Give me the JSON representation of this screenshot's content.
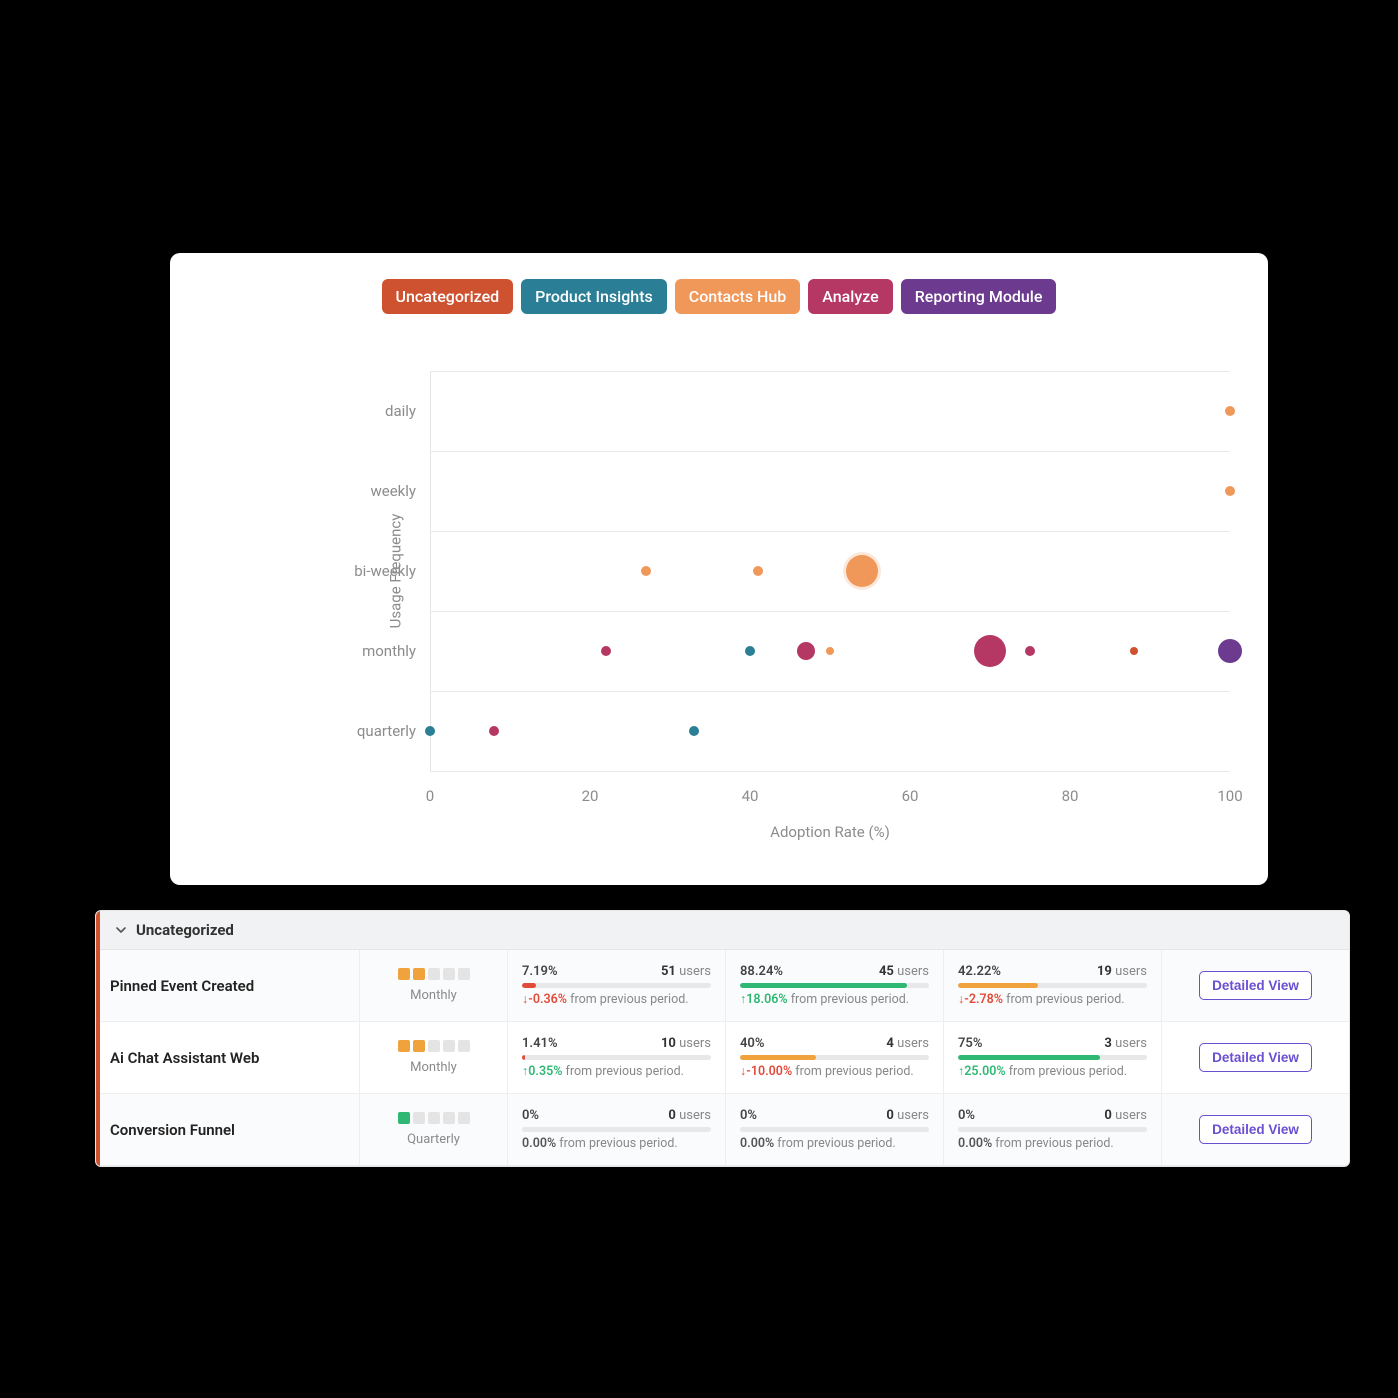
{
  "chart_data": {
    "type": "bubble",
    "xlabel": "Adoption Rate (%)",
    "ylabel": "Usage Frequency",
    "x_ticks": [
      0,
      20,
      40,
      60,
      80,
      100
    ],
    "y_categories": [
      "daily",
      "weekly",
      "bi-weekly",
      "monthly",
      "quarterly"
    ],
    "legend": [
      {
        "name": "Uncategorized",
        "color": "#cf5230"
      },
      {
        "name": "Product Insights",
        "color": "#2a7e95"
      },
      {
        "name": "Contacts Hub",
        "color": "#f0975a"
      },
      {
        "name": "Analyze",
        "color": "#b53764"
      },
      {
        "name": "Reporting Module",
        "color": "#6c3a8f"
      }
    ],
    "points": [
      {
        "x": 100,
        "y": "daily",
        "series": "Contacts Hub",
        "size": 1.0
      },
      {
        "x": 100,
        "y": "weekly",
        "series": "Contacts Hub",
        "size": 1.0
      },
      {
        "x": 27,
        "y": "bi-weekly",
        "series": "Contacts Hub",
        "size": 1.0
      },
      {
        "x": 41,
        "y": "bi-weekly",
        "series": "Contacts Hub",
        "size": 1.0
      },
      {
        "x": 54,
        "y": "bi-weekly",
        "series": "Contacts Hub",
        "size": 3.2
      },
      {
        "x": 22,
        "y": "monthly",
        "series": "Analyze",
        "size": 1.0
      },
      {
        "x": 40,
        "y": "monthly",
        "series": "Product Insights",
        "size": 1.0
      },
      {
        "x": 47,
        "y": "monthly",
        "series": "Analyze",
        "size": 1.8
      },
      {
        "x": 50,
        "y": "monthly",
        "series": "Contacts Hub",
        "size": 0.8
      },
      {
        "x": 70,
        "y": "monthly",
        "series": "Analyze",
        "size": 3.2
      },
      {
        "x": 75,
        "y": "monthly",
        "series": "Analyze",
        "size": 1.0
      },
      {
        "x": 88,
        "y": "monthly",
        "series": "Uncategorized",
        "size": 0.8
      },
      {
        "x": 100,
        "y": "monthly",
        "series": "Reporting Module",
        "size": 2.4
      },
      {
        "x": 0,
        "y": "quarterly",
        "series": "Product Insights",
        "size": 1.0
      },
      {
        "x": 8,
        "y": "quarterly",
        "series": "Analyze",
        "size": 1.0
      },
      {
        "x": 33,
        "y": "quarterly",
        "series": "Product Insights",
        "size": 1.0
      }
    ]
  },
  "legend": {
    "uncat": "Uncategorized",
    "prod": "Product Insights",
    "cont": "Contacts Hub",
    "anal": "Analyze",
    "rep": "Reporting Module"
  },
  "axes": {
    "xlabel": "Adoption Rate (%)",
    "ylabel": "Usage Frequency",
    "xticks": {
      "t0": "0",
      "t20": "20",
      "t40": "40",
      "t60": "60",
      "t80": "80",
      "t100": "100"
    },
    "yticks": {
      "daily": "daily",
      "weekly": "weekly",
      "biweekly": "bi-weekly",
      "monthly": "monthly",
      "quarterly": "quarterly"
    }
  },
  "table": {
    "section_title": "Uncategorized",
    "detailed_label": "Detailed View",
    "users_label": "users",
    "delta_suffix": "from previous period.",
    "rows": [
      {
        "name": "Pinned Event Created",
        "freq_label": "Monthly",
        "freq_kind": "orange",
        "freq_filled": 2,
        "metrics": [
          {
            "pct": "7.19%",
            "users": "51",
            "bar": 7.19,
            "bar_color": "red",
            "delta_dir": "down",
            "delta": "-0.36%"
          },
          {
            "pct": "88.24%",
            "users": "45",
            "bar": 88.24,
            "bar_color": "green",
            "delta_dir": "up",
            "delta": "18.06%"
          },
          {
            "pct": "42.22%",
            "users": "19",
            "bar": 42.22,
            "bar_color": "orange",
            "delta_dir": "down",
            "delta": "-2.78%"
          }
        ]
      },
      {
        "name": "Ai Chat Assistant Web",
        "freq_label": "Monthly",
        "freq_kind": "orange",
        "freq_filled": 2,
        "metrics": [
          {
            "pct": "1.41%",
            "users": "10",
            "bar": 1.41,
            "bar_color": "red",
            "delta_dir": "up",
            "delta": "0.35%"
          },
          {
            "pct": "40%",
            "users": "4",
            "bar": 40,
            "bar_color": "orange",
            "delta_dir": "down",
            "delta": "-10.00%"
          },
          {
            "pct": "75%",
            "users": "3",
            "bar": 75,
            "bar_color": "green",
            "delta_dir": "up",
            "delta": "25.00%"
          }
        ]
      },
      {
        "name": "Conversion Funnel",
        "freq_label": "Quarterly",
        "freq_kind": "green",
        "freq_filled": 1,
        "metrics": [
          {
            "pct": "0%",
            "users": "0",
            "bar": 0,
            "bar_color": "red",
            "delta_dir": "neutral",
            "delta": "0.00%"
          },
          {
            "pct": "0%",
            "users": "0",
            "bar": 0,
            "bar_color": "red",
            "delta_dir": "neutral",
            "delta": "0.00%"
          },
          {
            "pct": "0%",
            "users": "0",
            "bar": 0,
            "bar_color": "red",
            "delta_dir": "neutral",
            "delta": "0.00%"
          }
        ]
      }
    ]
  }
}
